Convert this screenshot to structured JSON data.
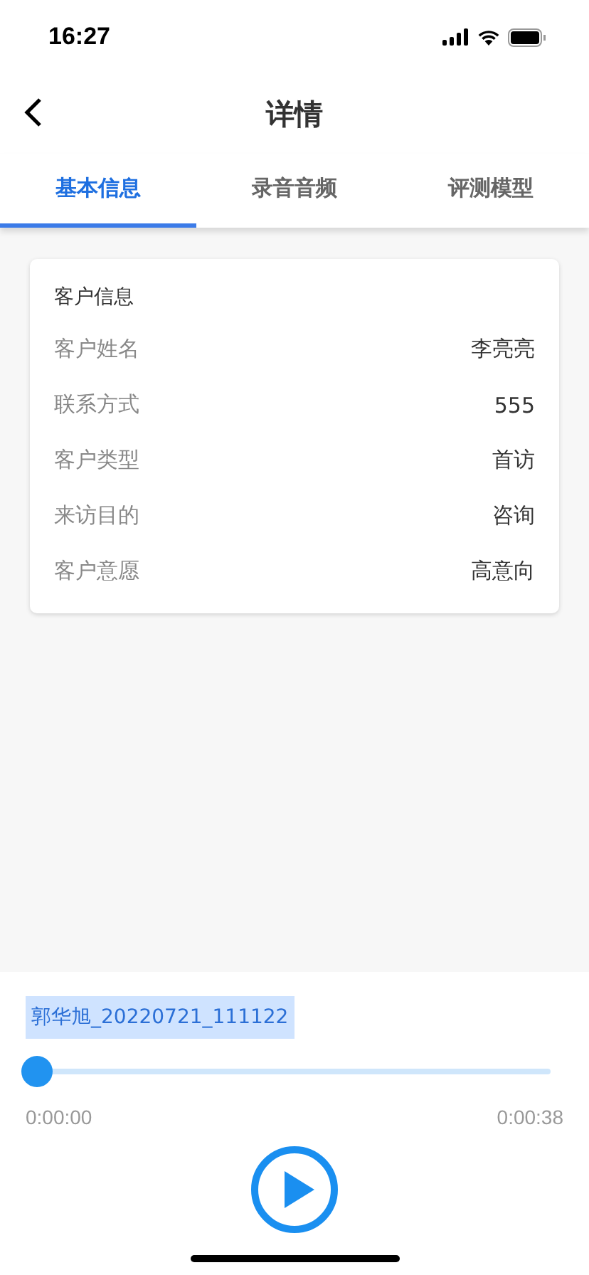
{
  "status_bar": {
    "time": "16:27"
  },
  "nav": {
    "title": "详情"
  },
  "tabs": [
    {
      "label": "基本信息",
      "selected": true
    },
    {
      "label": "录音音频",
      "selected": false
    },
    {
      "label": "评测模型",
      "selected": false
    }
  ],
  "card": {
    "title": "客户信息",
    "rows": [
      {
        "label": "客户姓名",
        "value": "李亮亮"
      },
      {
        "label": "联系方式",
        "value": "555"
      },
      {
        "label": "客户类型",
        "value": "首访"
      },
      {
        "label": "来访目的",
        "value": "咨询"
      },
      {
        "label": "客户意愿",
        "value": "高意向"
      }
    ]
  },
  "player": {
    "file_name": "郭华旭_20220721_111122",
    "level": 0,
    "elapsed": "0:00:00",
    "duration": "0:00:38"
  }
}
